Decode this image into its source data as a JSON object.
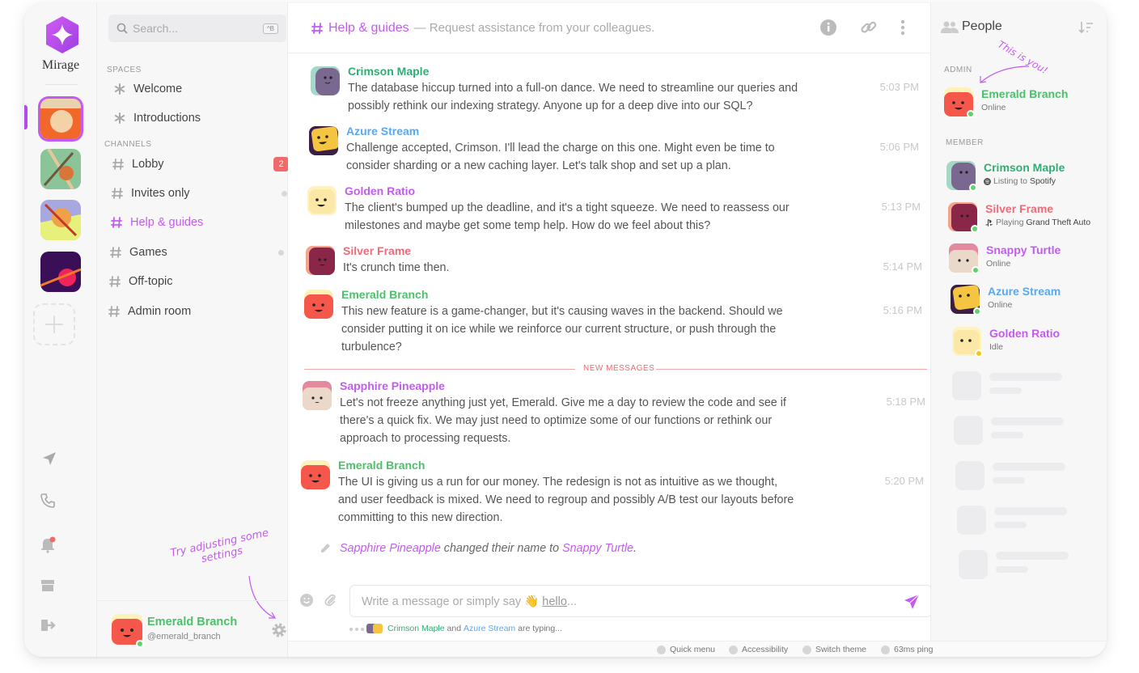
{
  "brand": {
    "name": "Mirage"
  },
  "search": {
    "placeholder": "Search...",
    "shortcut": "^B"
  },
  "sidebar": {
    "spaces_label": "SPACES",
    "spaces": [
      {
        "label": "Welcome"
      },
      {
        "label": "Introductions"
      }
    ],
    "channels_label": "CHANNELS",
    "channels": [
      {
        "label": "Lobby",
        "badge": "2"
      },
      {
        "label": "Invites only"
      },
      {
        "label": "Help & guides"
      },
      {
        "label": "Games"
      },
      {
        "label": "Off-topic"
      },
      {
        "label": "Admin room"
      }
    ],
    "hint": "Try adjusting some settings"
  },
  "me": {
    "name": "Emerald Branch",
    "handle": "@emerald_branch"
  },
  "chat": {
    "title": "Help & guides",
    "description": "— Request assistance from your colleagues.",
    "messages": [
      {
        "author": "Crimson Maple",
        "text": "The database hiccup turned into a full-on dance. We need to streamline our queries and possibly rethink our indexing strategy. Anyone up for a deep dive into our SQL?",
        "time": "5:03 PM"
      },
      {
        "author": "Azure Stream",
        "text": "Challenge accepted, Crimson. I'll lead the charge on this one. Might even be time to consider sharding or a new caching layer. Let's talk shop and set up a plan.",
        "time": "5:06 PM"
      },
      {
        "author": "Golden Ratio",
        "text": "The client's bumped up the deadline, and it's a tight squeeze. We need to reassess our milestones and maybe get some temp help. How do we feel about this?",
        "time": "5:13 PM"
      },
      {
        "author": "Silver Frame",
        "text": "It's crunch time then.",
        "time": "5:14 PM"
      },
      {
        "author": "Emerald Branch",
        "text": "This new feature is a game-changer, but it's causing waves in the backend. Should we consider putting it on ice while we reinforce our current structure, or push through the turbulence?",
        "time": "5:16 PM"
      },
      {
        "author": "Sapphire Pineapple",
        "text": "Let's not freeze anything just yet, Emerald. Give me a day to review the code and see if there's a quick fix. We may just need to optimize some of our functions or rethink our approach to processing requests.",
        "time": "5:18 PM"
      },
      {
        "author": "Emerald Branch",
        "text": "The UI is giving us a run for our money. The redesign is not as intuitive as we thought, and user feedback is mixed. We need to regroup and possibly A/B test our layouts before committing to this new direction.",
        "time": "5:20 PM"
      }
    ],
    "new_messages_label": "NEW MESSAGES",
    "system": {
      "old_name": "Sapphire Pineapple",
      "middle": "changed their name to",
      "new_name": "Snappy Turtle",
      "end": "."
    },
    "composer": {
      "placeholder_pre": "Write a message or simply say ",
      "wave": "👋",
      "hello": "hello",
      "placeholder_post": "..."
    },
    "typing": {
      "user1": "Crimson Maple",
      "and": "and",
      "user2": "Azure Stream",
      "suffix": "are typing..."
    }
  },
  "footer": {
    "quick_menu": "Quick menu",
    "accessibility": "Accessibility",
    "switch_theme": "Switch theme",
    "ping": "63ms ping"
  },
  "people": {
    "title": "People",
    "admin_label": "ADMIN",
    "you_hint": "This is you!",
    "admin": {
      "name": "Emerald Branch",
      "status": "Online"
    },
    "member_label": "MEMBER",
    "members": [
      {
        "name": "Crimson Maple",
        "status_prefix": "Listing to",
        "status_target": "Spotify"
      },
      {
        "name": "Silver Frame",
        "status_prefix": "Playing",
        "status_target": "Grand Theft Auto"
      },
      {
        "name": "Snappy Turtle",
        "status": "Online"
      },
      {
        "name": "Azure Stream",
        "status": "Online"
      },
      {
        "name": "Golden Ratio",
        "status": "Idle"
      }
    ]
  },
  "colors": {
    "accent": "#c45bf0",
    "emerald": "#4cc06a",
    "crimson": "#2fae74",
    "azure": "#5aa8f0",
    "golden": "#c45bf0",
    "silver": "#f06a7a",
    "online": "#5ed36b",
    "idle": "#f5c518",
    "badge": "#f06a6a"
  }
}
